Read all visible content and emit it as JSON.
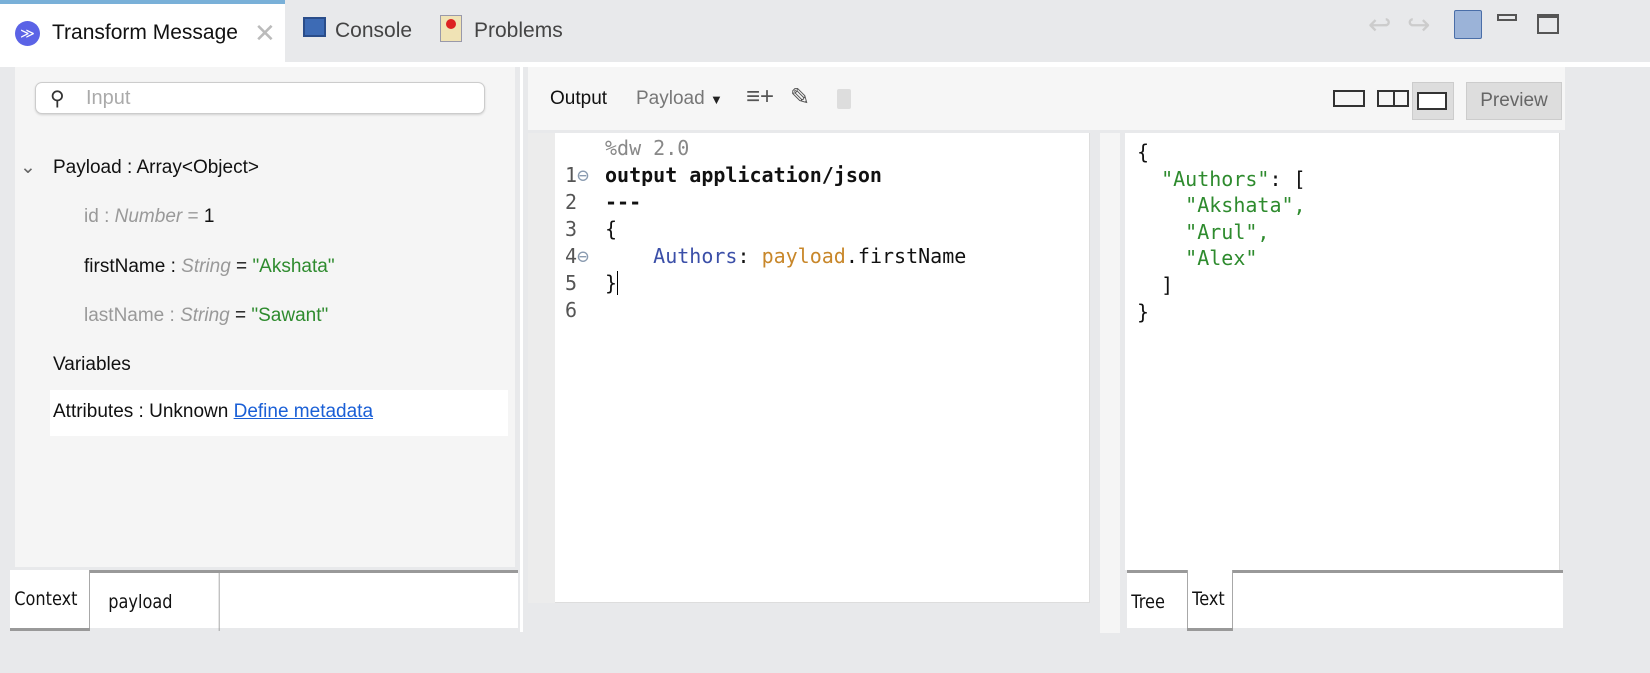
{
  "tabs": [
    {
      "label": "Transform Message",
      "icon": "dataweave-icon",
      "active": true,
      "closable": true
    },
    {
      "label": "Console",
      "icon": "console-icon"
    },
    {
      "label": "Problems",
      "icon": "problems-icon"
    }
  ],
  "window_controls": [
    "undo-icon",
    "redo-icon",
    "save-icon",
    "minimize-icon",
    "maximize-icon"
  ],
  "input_panel": {
    "search_placeholder": "Input",
    "payload": {
      "label": "Payload : Array<Object>",
      "expanded": true,
      "fields": [
        {
          "name": "id",
          "type": "Number",
          "value": "1"
        },
        {
          "name": "firstName",
          "type": "String",
          "value": "\"Akshata\""
        },
        {
          "name": "lastName",
          "type": "String",
          "value": "\"Sawant\""
        }
      ]
    },
    "variables": "Variables",
    "attributes": {
      "label": "Attributes : Unknown",
      "link": "Define metadata"
    },
    "bottom_tabs": [
      "Context",
      "payload"
    ],
    "active_bottom_tab": "Context"
  },
  "toolbar": {
    "output_label": "Output",
    "target": "Payload",
    "preview_label": "Preview"
  },
  "editor": {
    "lines": [
      {
        "n": "1",
        "text": "%dw 2.0"
      },
      {
        "n": "2",
        "text": "output application/json"
      },
      {
        "n": "3",
        "text": "---"
      },
      {
        "n": "4",
        "text": "{"
      },
      {
        "n": "5",
        "key": "Authors",
        "sep": ": ",
        "obj": "payload",
        "rest": ".firstName"
      },
      {
        "n": "6",
        "text": "}"
      }
    ]
  },
  "preview": {
    "lines": [
      "{",
      "  \"Authors\": [",
      "    \"Akshata\",",
      "    \"Arul\",",
      "    \"Alex\"",
      "  ]",
      "}"
    ],
    "bottom_tabs": [
      "Tree",
      "Text"
    ],
    "active_bottom_tab": "Text"
  },
  "colors": {
    "keyword_blue": "#3b4fa8",
    "orange": "#c8872a",
    "string_green": "#2e8b2e",
    "link": "#1a5fd6"
  }
}
